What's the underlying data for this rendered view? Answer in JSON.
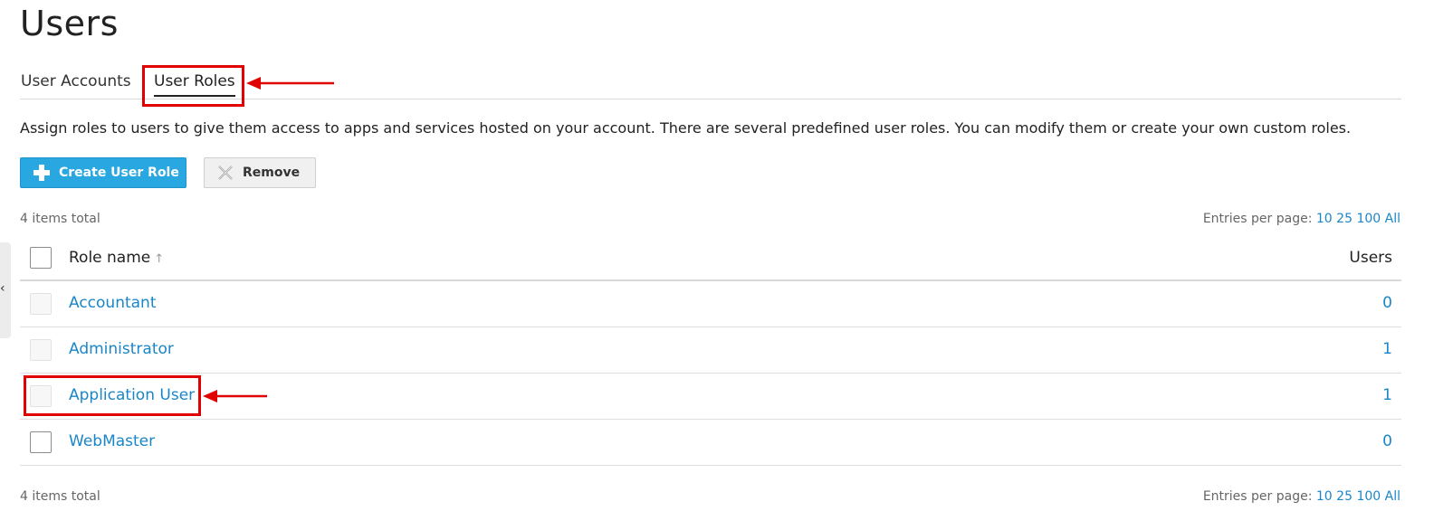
{
  "page": {
    "title": "Users"
  },
  "tabs": [
    {
      "label": "User Accounts",
      "active": false
    },
    {
      "label": "User Roles",
      "active": true
    }
  ],
  "description": "Assign roles to users to give them access to apps and services hosted on your account. There are several predefined user roles. You can modify them or create your own custom roles.",
  "toolbar": {
    "create_label": "Create User Role",
    "remove_label": "Remove"
  },
  "list": {
    "total_text": "4 items total",
    "entries_label": "Entries per page:",
    "page_sizes": [
      "10",
      "25",
      "100",
      "All"
    ],
    "columns": {
      "role_name": "Role name",
      "sort_indicator": "↑",
      "users": "Users"
    },
    "rows": [
      {
        "role": "Accountant",
        "users": "0",
        "selectable": false
      },
      {
        "role": "Administrator",
        "users": "1",
        "selectable": false
      },
      {
        "role": "Application User",
        "users": "1",
        "selectable": false
      },
      {
        "role": "WebMaster",
        "users": "0",
        "selectable": true
      }
    ]
  },
  "side_handle": {
    "icon": "‹"
  },
  "colors": {
    "accent": "#28a7e1",
    "link": "#1a86c8",
    "annotation": "#e00000"
  }
}
